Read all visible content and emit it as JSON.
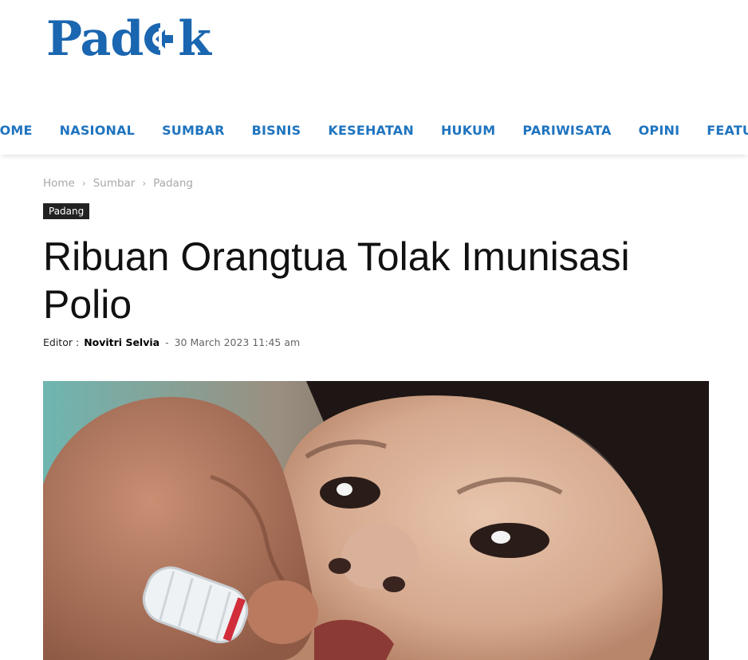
{
  "site": {
    "logo_text_left": "Pad",
    "logo_text_right": "k",
    "brand_color": "#1a66b0"
  },
  "nav": {
    "items": [
      "HOME",
      "NASIONAL",
      "SUMBAR",
      "BISNIS",
      "KESEHATAN",
      "HUKUM",
      "PARIWISATA",
      "OPINI",
      "FEATURE"
    ],
    "color": "#1f74bf"
  },
  "breadcrumb": {
    "items": [
      "Home",
      "Sumbar",
      "Padang"
    ],
    "separator": "›"
  },
  "article": {
    "category": "Padang",
    "title": "Ribuan Orangtua Tolak Imunisasi Polio",
    "editor_label": "Editor :",
    "author": "Novitri Selvia",
    "dash": "-",
    "date": "30 March 2023 11:45 am"
  },
  "hero_image": {
    "subject": "baby-receiving-oral-polio-vaccine-photo"
  }
}
